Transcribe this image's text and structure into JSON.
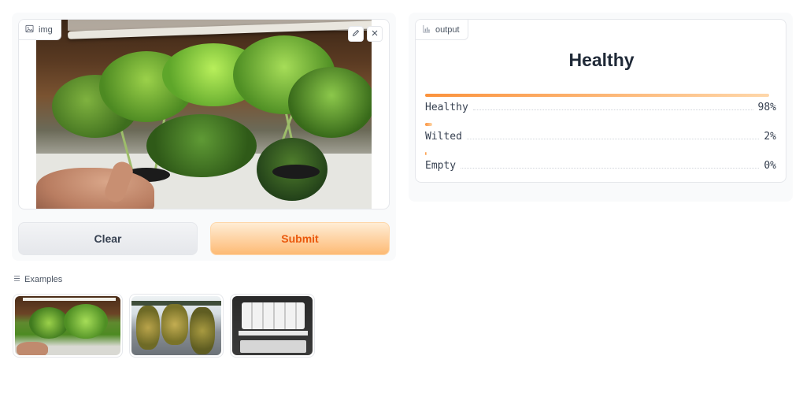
{
  "input": {
    "label": "img",
    "icon": "image-icon",
    "edit_icon": "pencil-icon",
    "clear_icon": "close-icon"
  },
  "buttons": {
    "clear": "Clear",
    "submit": "Submit"
  },
  "output": {
    "label": "output",
    "icon": "bar-chart-icon",
    "top_label": "Healthy",
    "confidences": [
      {
        "label": "Healthy",
        "value": "98%",
        "fraction": 0.98
      },
      {
        "label": "Wilted",
        "value": "2%",
        "fraction": 0.02
      },
      {
        "label": "Empty",
        "value": "0%",
        "fraction": 0.0
      }
    ]
  },
  "examples": {
    "label": "Examples",
    "icon": "list-icon",
    "items": [
      "healthy-kale-thumbnail",
      "wilted-plants-thumbnail",
      "empty-planter-thumbnail"
    ]
  },
  "colors": {
    "accent": "#ea580c",
    "bar_start": "#fb923c",
    "bar_end": "#fed7aa"
  }
}
